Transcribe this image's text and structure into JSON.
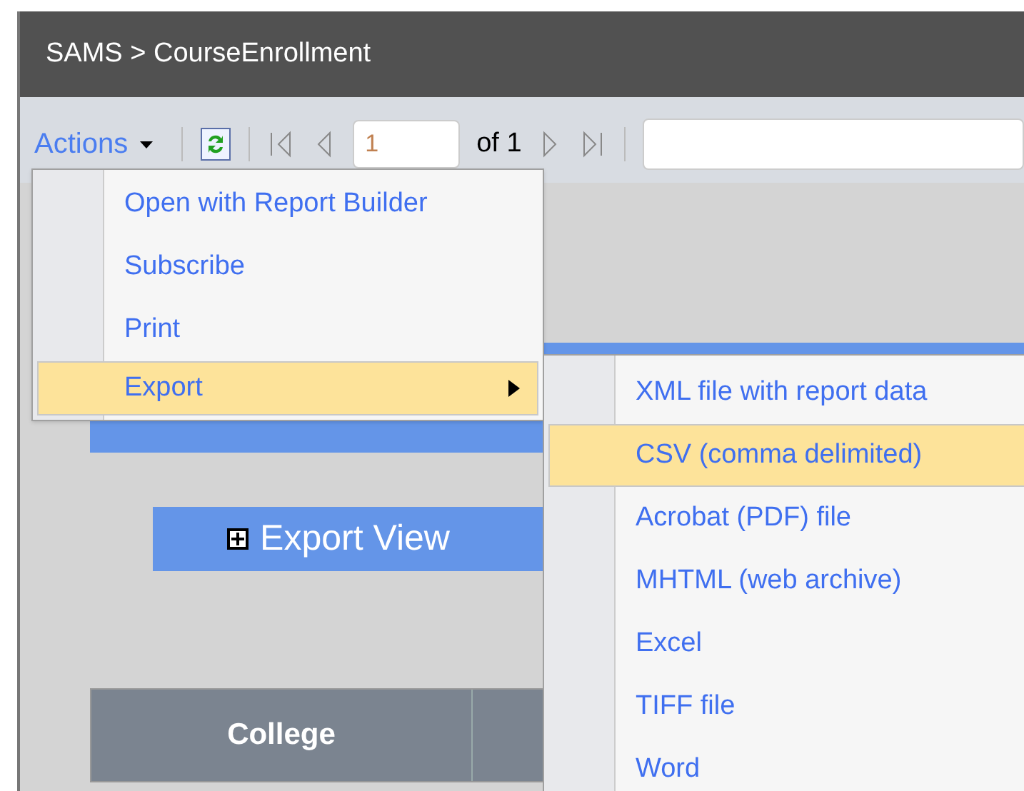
{
  "breadcrumb": "SAMS > CourseEnrollment",
  "toolbar": {
    "actions_label": "Actions",
    "page_value": "1",
    "page_of": "of 1"
  },
  "export_view_button": {
    "label": "Export View",
    "expanded": false
  },
  "table": {
    "columns": [
      "College"
    ]
  },
  "actions_menu": [
    {
      "label": "Open with Report Builder",
      "selected": false,
      "has_submenu": false
    },
    {
      "label": "Subscribe",
      "selected": false,
      "has_submenu": false
    },
    {
      "label": "Print",
      "selected": false,
      "has_submenu": false
    },
    {
      "label": "Export",
      "selected": true,
      "has_submenu": true
    }
  ],
  "export_menu": [
    {
      "label": "XML file with report data",
      "selected": false
    },
    {
      "label": "CSV (comma delimited)",
      "selected": true
    },
    {
      "label": "Acrobat (PDF) file",
      "selected": false
    },
    {
      "label": "MHTML (web archive)",
      "selected": false
    },
    {
      "label": "Excel",
      "selected": false
    },
    {
      "label": "TIFF file",
      "selected": false
    },
    {
      "label": "Word",
      "selected": false
    }
  ]
}
